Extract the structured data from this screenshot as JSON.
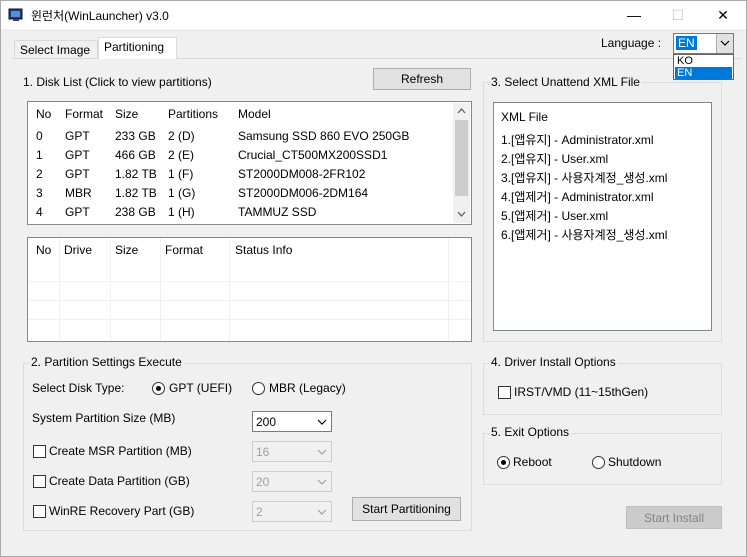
{
  "window": {
    "title": "윈런처(WinLauncher) v3.0",
    "min_symbol": "—",
    "max_symbol": "☐",
    "close_symbol": "✕",
    "icon": "app-icon"
  },
  "tabs": [
    {
      "label": "Select Image",
      "active": false
    },
    {
      "label": "Partitioning",
      "active": true
    }
  ],
  "language": {
    "label": "Language :",
    "selected": "EN",
    "options": [
      "KO",
      "EN"
    ]
  },
  "disk_list": {
    "title": "1. Disk List (Click to view partitions)",
    "refresh_label": "Refresh",
    "columns": [
      "No",
      "Format",
      "Size",
      "Partitions",
      "Model"
    ],
    "rows": [
      [
        "0",
        "GPT",
        "233 GB",
        "2 (D)",
        "Samsung SSD 860 EVO 250GB"
      ],
      [
        "1",
        "GPT",
        "466 GB",
        "2 (E)",
        "Crucial_CT500MX200SSD1"
      ],
      [
        "2",
        "GPT",
        "1.82 TB",
        "1 (F)",
        "ST2000DM008-2FR102"
      ],
      [
        "3",
        "MBR",
        "1.82 TB",
        "1 (G)",
        "ST2000DM006-2DM164"
      ],
      [
        "4",
        "GPT",
        "238 GB",
        "1 (H)",
        "TAMMUZ SSD"
      ]
    ]
  },
  "partition_list": {
    "columns": [
      "No",
      "Drive",
      "Size",
      "Format",
      "Status Info"
    ]
  },
  "partition_settings": {
    "title": "2. Partition Settings  Execute",
    "disk_type_label": "Select Disk Type:",
    "gpt_label": "GPT (UEFI)",
    "mbr_label": "MBR (Legacy)",
    "disk_type_selected": "GPT",
    "system_size_label": "System Partition Size (MB)",
    "system_size_value": "200",
    "msr_label": "Create MSR Partition (MB)",
    "msr_value": "16",
    "data_label": "Create Data Partition (GB)",
    "data_value": "20",
    "winre_label": "WinRE Recovery Part (GB)",
    "winre_value": "2",
    "start_label": "Start Partitioning"
  },
  "unattend": {
    "title": "3. Select Unattend XML File",
    "header": "XML File",
    "items": [
      "1.[앱유지] - Administrator.xml",
      "2.[앱유지] - User.xml",
      "3.[앱유지] - 사용자계정_생성.xml",
      "4.[앱제거] - Administrator.xml",
      "5.[앱제거] - User.xml",
      "6.[앱제거] - 사용자계정_생성.xml"
    ]
  },
  "driver": {
    "title": "4. Driver Install Options",
    "irst_label": "IRST/VMD (11~15thGen)"
  },
  "exit": {
    "title": "5. Exit Options",
    "reboot_label": "Reboot",
    "shutdown_label": "Shutdown",
    "selected": "Reboot"
  },
  "install_label": "Start Install",
  "colors": {
    "selection": "#0078d7",
    "window_bg": "#f0f0f0",
    "disabled_text": "#a0a0a0"
  }
}
